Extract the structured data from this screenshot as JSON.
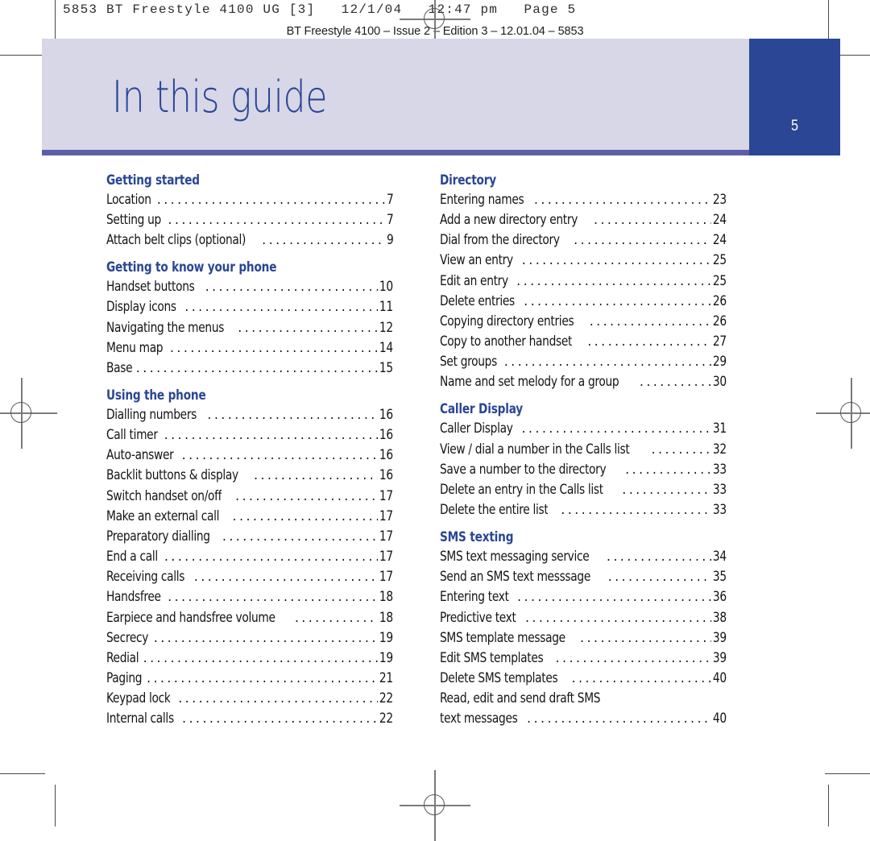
{
  "prepress": {
    "job_slug": "5853 BT Freestyle 4100 UG [3]   12/1/04   12:47 pm   Page 5",
    "edition_slug": "BT Freestyle 4100 – Issue 2 – Edition 3 – 12.01.04 – 5853"
  },
  "header": {
    "title": "In this guide",
    "page_number": "5",
    "band_color": "#d7d7e8",
    "accent_color": "#2a4694",
    "rule_color": "#5d5da8"
  },
  "columns": {
    "left": [
      {
        "title": "Getting started",
        "entries": [
          {
            "label": "Location",
            "page": "7"
          },
          {
            "label": "Setting up",
            "page": "7"
          },
          {
            "label": "Attach belt clips (optional)",
            "page": "9"
          }
        ]
      },
      {
        "title": "Getting to know your phone",
        "entries": [
          {
            "label": "Handset buttons",
            "page": "10"
          },
          {
            "label": "Display icons",
            "page": "11"
          },
          {
            "label": "Navigating the menus",
            "page": "12"
          },
          {
            "label": "Menu map",
            "page": "14"
          },
          {
            "label": "Base",
            "page": "15"
          }
        ]
      },
      {
        "title": "Using the phone",
        "entries": [
          {
            "label": "Dialling numbers",
            "page": "16"
          },
          {
            "label": "Call timer",
            "page": "16"
          },
          {
            "label": "Auto-answer",
            "page": "16"
          },
          {
            "label": "Backlit buttons & display",
            "page": "16"
          },
          {
            "label": "Switch handset on/off",
            "page": "17"
          },
          {
            "label": "Make an external call",
            "page": "17"
          },
          {
            "label": "Preparatory dialling",
            "page": "17"
          },
          {
            "label": "End a call",
            "page": "17"
          },
          {
            "label": "Receiving calls",
            "page": "17"
          },
          {
            "label": "Handsfree",
            "page": "18"
          },
          {
            "label": "Earpiece and handsfree volume",
            "page": "18"
          },
          {
            "label": "Secrecy",
            "page": "19"
          },
          {
            "label": "Redial",
            "page": "19"
          },
          {
            "label": "Paging",
            "page": "21"
          },
          {
            "label": "Keypad lock",
            "page": "22"
          },
          {
            "label": "Internal calls",
            "page": "22"
          }
        ]
      }
    ],
    "right": [
      {
        "title": "Directory",
        "entries": [
          {
            "label": "Entering names",
            "page": "23"
          },
          {
            "label": "Add a new directory entry",
            "page": "24"
          },
          {
            "label": "Dial from the directory",
            "page": "24"
          },
          {
            "label": "View an entry",
            "page": "25"
          },
          {
            "label": "Edit an entry",
            "page": "25"
          },
          {
            "label": "Delete entries",
            "page": "26"
          },
          {
            "label": "Copying directory entries",
            "page": "26"
          },
          {
            "label": "Copy to another handset",
            "page": "27"
          },
          {
            "label": "Set groups",
            "page": "29"
          },
          {
            "label": "Name and set melody for a group",
            "page": "30"
          }
        ]
      },
      {
        "title": "Caller Display",
        "entries": [
          {
            "label": "Caller Display",
            "page": "31"
          },
          {
            "label": "View / dial a number in the Calls list",
            "page": "32"
          },
          {
            "label": "Save a number to the directory",
            "page": "33"
          },
          {
            "label": "Delete an entry in the Calls list",
            "page": "33"
          },
          {
            "label": "Delete the entire list",
            "page": "33"
          }
        ]
      },
      {
        "title": "SMS texting",
        "entries": [
          {
            "label": "SMS text messaging service",
            "page": "34"
          },
          {
            "label": "Send an SMS text messsage",
            "page": "35"
          },
          {
            "label": "Entering text",
            "page": "36"
          },
          {
            "label": "Predictive text",
            "page": "38"
          },
          {
            "label": "SMS template message",
            "page": "39"
          },
          {
            "label": "Edit SMS templates",
            "page": "39"
          },
          {
            "label": "Delete SMS templates",
            "page": "40"
          },
          {
            "label": "Read, edit and send draft SMS",
            "page": "",
            "no_leader": true
          },
          {
            "label": "text messages",
            "page": "40"
          }
        ]
      }
    ]
  }
}
